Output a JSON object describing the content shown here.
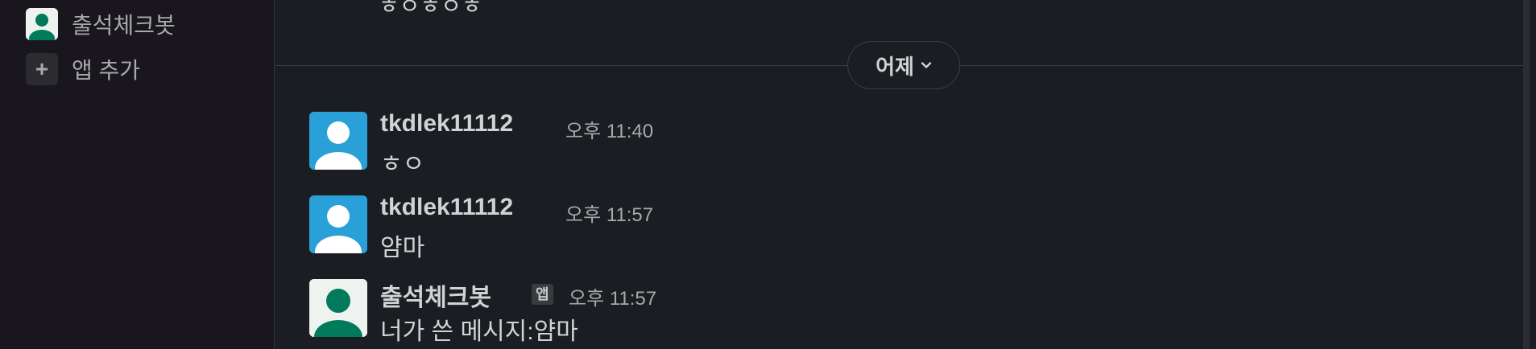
{
  "sidebar": {
    "items": [
      {
        "label": "출석체크봇",
        "icon": "bot-avatar-icon"
      },
      {
        "label": "앱 추가",
        "icon": "plus-icon"
      }
    ]
  },
  "main": {
    "clipped_message": "ㅎㅇㅎㅇㅎ",
    "date_divider": {
      "label": "어제",
      "icon": "chevron-down-icon"
    },
    "messages": [
      {
        "author": "tkdlek11112",
        "time": "오후 11:40",
        "text": "ㅎㅇ",
        "avatar_color": "#2aa0d8"
      },
      {
        "author": "tkdlek11112",
        "time": "오후 11:57",
        "text": "얌마",
        "avatar_color": "#2aa0d8"
      },
      {
        "author": "출석체크봇",
        "badge": "앱",
        "time": "오후 11:57",
        "text": "너가 쓴 메시지:얌마",
        "avatar_color": "#007a5a"
      }
    ]
  },
  "colors": {
    "background": "#1a1d21",
    "sidebar": "#19171d",
    "text": "#d1d2d3",
    "muted": "#a9a9ab",
    "user_avatar": "#2aa0d8",
    "bot_avatar": "#007a5a"
  }
}
